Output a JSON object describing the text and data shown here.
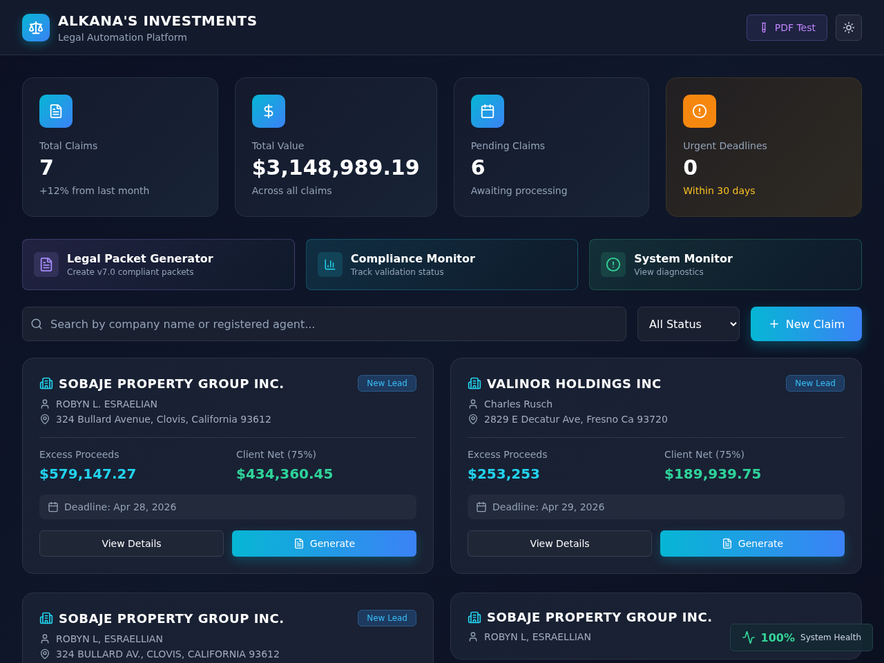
{
  "header": {
    "title": "ALKANA'S INVESTMENTS",
    "subtitle": "Legal Automation Platform",
    "pdf_button": "PDF Test"
  },
  "stats": [
    {
      "kind": "doc",
      "label": "Total Claims",
      "value": "7",
      "note": "+12% from last month",
      "urgent": false
    },
    {
      "kind": "dollar",
      "label": "Total Value",
      "value": "$3,148,989.19",
      "note": "Across all claims",
      "urgent": false
    },
    {
      "kind": "calendar",
      "label": "Pending Claims",
      "value": "6",
      "note": "Awaiting processing",
      "urgent": false
    },
    {
      "kind": "alert",
      "label": "Urgent Deadlines",
      "value": "0",
      "note": "Within 30 days",
      "urgent": true
    }
  ],
  "tools": [
    {
      "kind": "doc",
      "title": "Legal Packet Generator",
      "subtitle": "Create v7.0 compliant packets",
      "color": "#a78bfa"
    },
    {
      "kind": "chart",
      "title": "Compliance Monitor",
      "subtitle": "Track validation status",
      "color": "#22d3ee"
    },
    {
      "kind": "alert",
      "title": "System Monitor",
      "subtitle": "View diagnostics",
      "color": "#34d399"
    }
  ],
  "search": {
    "placeholder": "Search by company name or registered agent..."
  },
  "status_filter": "All Status",
  "new_claim_button": "New Claim",
  "claims": [
    {
      "company": "SOBAJE PROPERTY GROUP INC.",
      "badge": "New Lead",
      "agent": "ROBYN L. ESRAELIAN",
      "address": "324 Bullard Avenue, Clovis, California 93612",
      "excess_label": "Excess Proceeds",
      "excess": "$579,147.27",
      "net_label": "Client Net (75%)",
      "net": "$434,360.45",
      "deadline": "Deadline: Apr 28, 2026",
      "details_button": "View Details",
      "generate_button": "Generate"
    },
    {
      "company": "VALINOR HOLDINGS INC",
      "badge": "New Lead",
      "agent": "Charles Rusch",
      "address": "2829 E Decatur Ave, Fresno Ca 93720",
      "excess_label": "Excess Proceeds",
      "excess": "$253,253",
      "net_label": "Client Net (75%)",
      "net": "$189,939.75",
      "deadline": "Deadline: Apr 29, 2026",
      "details_button": "View Details",
      "generate_button": "Generate"
    },
    {
      "company": "SOBAJE PROPERTY GROUP INC.",
      "badge": "New Lead",
      "agent": "ROBYN L, ESRAELLIAN",
      "address": "324 BULLARD AV., CLOVIS, CALIFORNIA 93612"
    },
    {
      "company": "SOBAJE PROPERTY GROUP INC.",
      "agent": "ROBYN L, ESRAELLIAN"
    }
  ],
  "health_widget": {
    "value": "100%",
    "label": "System Health"
  }
}
